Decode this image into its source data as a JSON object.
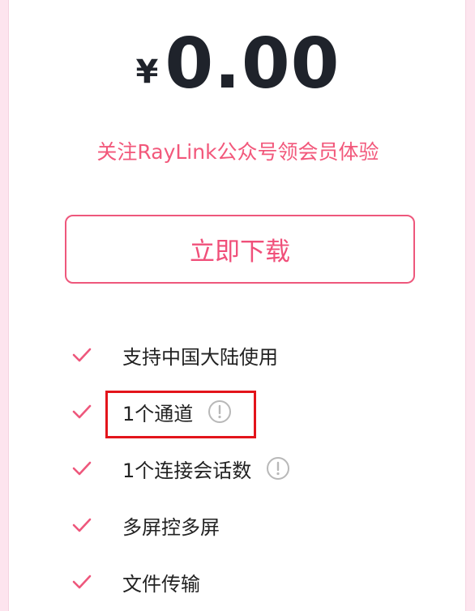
{
  "pricing": {
    "currency_symbol": "¥",
    "amount": "0.00",
    "subtitle": "关注RayLink公众号领会员体验",
    "download_label": "立即下载"
  },
  "features": [
    {
      "label": "支持中国大陆使用",
      "has_info": false
    },
    {
      "label": "1个通道",
      "has_info": true
    },
    {
      "label": "1个连接会话数",
      "has_info": true
    },
    {
      "label": "多屏控多屏",
      "has_info": false
    },
    {
      "label": "文件传输",
      "has_info": false
    }
  ],
  "colors": {
    "accent": "#ee577c",
    "subtitle": "#f2587b",
    "price": "#1f232b",
    "highlight_box": "#e3141b",
    "background": "#fde4ee"
  },
  "icons": {
    "check": "check-icon",
    "info": "info-icon"
  }
}
